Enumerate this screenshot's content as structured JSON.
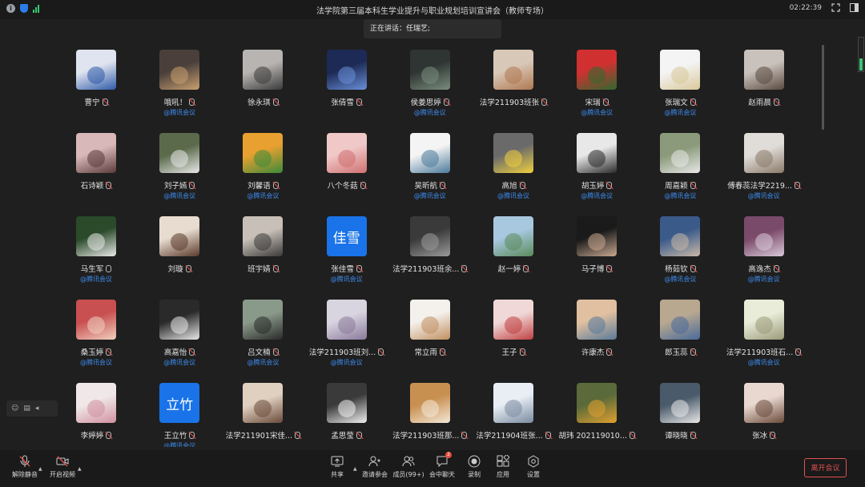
{
  "window": {
    "title": "法学院第三届本科生学业提升与职业规划培训宣讲会（教师专场）",
    "clock": "02:22:39"
  },
  "speaking": {
    "text": "正在讲话：任瑞艺;"
  },
  "platform_label": "@腾讯会议",
  "participants": [
    {
      "name": "曹宁",
      "muted": true,
      "show_platform": false,
      "avatar": {
        "type": "photo",
        "bg": "#dfe4f0",
        "fg": "#2f5aa8",
        "text": ""
      }
    },
    {
      "name": "哦吼！",
      "muted": true,
      "show_platform": true,
      "avatar": {
        "type": "photo",
        "bg": "#4a3f3a",
        "fg": "#c8a070",
        "text": ""
      }
    },
    {
      "name": "徐永琪",
      "muted": true,
      "show_platform": false,
      "avatar": {
        "type": "photo",
        "bg": "#b8b4b2",
        "fg": "#3a3a3a",
        "text": ""
      }
    },
    {
      "name": "张倩雪",
      "muted": false,
      "show_platform": false,
      "avatar": {
        "type": "photo",
        "bg": "#1c2a55",
        "fg": "#6a8fd8",
        "text": ""
      }
    },
    {
      "name": "侯姜思婷",
      "muted": true,
      "show_platform": true,
      "avatar": {
        "type": "photo",
        "bg": "#2f3533",
        "fg": "#7a8d7e",
        "text": ""
      }
    },
    {
      "name": "法学211903班张",
      "muted": true,
      "show_platform": false,
      "avatar": {
        "type": "photo",
        "bg": "#d8c8b8",
        "fg": "#b07850",
        "text": ""
      }
    },
    {
      "name": "宋瑞",
      "muted": true,
      "show_platform": true,
      "avatar": {
        "type": "photo",
        "bg": "#d03030",
        "fg": "#2f6a2f",
        "text": ""
      }
    },
    {
      "name": "张瑞文",
      "muted": true,
      "show_platform": true,
      "avatar": {
        "type": "photo",
        "bg": "#f4f4f4",
        "fg": "#d9c89a",
        "text": ""
      }
    },
    {
      "name": "赵雨晨",
      "muted": true,
      "show_platform": false,
      "avatar": {
        "type": "photo",
        "bg": "#c9c2bc",
        "fg": "#5a4a40",
        "text": ""
      }
    },
    {
      "name": "石诗颖",
      "muted": true,
      "show_platform": false,
      "avatar": {
        "type": "photo",
        "bg": "#d8b8b8",
        "fg": "#5a3a3a",
        "text": ""
      }
    },
    {
      "name": "刘子嫣",
      "muted": true,
      "show_platform": true,
      "avatar": {
        "type": "photo",
        "bg": "#5a6a4a",
        "fg": "#e8e8e8",
        "text": ""
      }
    },
    {
      "name": "刘馨语",
      "muted": true,
      "show_platform": true,
      "avatar": {
        "type": "photo",
        "bg": "#e8a030",
        "fg": "#3a8a3a",
        "text": ""
      }
    },
    {
      "name": "八个冬菇",
      "muted": true,
      "show_platform": false,
      "avatar": {
        "type": "photo",
        "bg": "#f0c8c8",
        "fg": "#d07070",
        "text": ""
      }
    },
    {
      "name": "吴昕航",
      "muted": true,
      "show_platform": true,
      "avatar": {
        "type": "photo",
        "bg": "#f4f4f4",
        "fg": "#4a7a9a",
        "text": ""
      }
    },
    {
      "name": "高旭",
      "muted": true,
      "show_platform": true,
      "avatar": {
        "type": "photo",
        "bg": "#6a6a6a",
        "fg": "#f0d040",
        "text": ""
      }
    },
    {
      "name": "胡玉婷",
      "muted": true,
      "show_platform": true,
      "avatar": {
        "type": "photo",
        "bg": "#e8e8e8",
        "fg": "#2a2a2a",
        "text": ""
      }
    },
    {
      "name": "周嘉颖",
      "muted": false,
      "show_platform": true,
      "avatar": {
        "type": "photo",
        "bg": "#8a9a7a",
        "fg": "#e8e8e8",
        "text": ""
      }
    },
    {
      "name": "傅春蕊法学2219...",
      "muted": true,
      "show_platform": true,
      "avatar": {
        "type": "photo",
        "bg": "#e0dcd8",
        "fg": "#8a7a6a",
        "text": ""
      }
    },
    {
      "name": "马生军",
      "muted": false,
      "show_platform": true,
      "mic_on": true,
      "avatar": {
        "type": "photo",
        "bg": "#2a4a2a",
        "fg": "#e8e8e8",
        "text": ""
      }
    },
    {
      "name": "刘璇",
      "muted": true,
      "show_platform": false,
      "avatar": {
        "type": "photo",
        "bg": "#e8dcd0",
        "fg": "#5a3a2a",
        "text": ""
      }
    },
    {
      "name": "班宇婧",
      "muted": true,
      "show_platform": false,
      "avatar": {
        "type": "photo",
        "bg": "#c8c0b8",
        "fg": "#3a3a3a",
        "text": ""
      }
    },
    {
      "name": "张佳雪",
      "muted": true,
      "show_platform": true,
      "avatar": {
        "type": "text",
        "bg": "#1a73e8",
        "fg": "#ffffff",
        "text": "佳雪"
      }
    },
    {
      "name": "法学211903班余...",
      "muted": true,
      "show_platform": false,
      "avatar": {
        "type": "photo",
        "bg": "#3a3a3a",
        "fg": "#9a9a9a",
        "text": ""
      }
    },
    {
      "name": "赵一婷",
      "muted": true,
      "show_platform": false,
      "avatar": {
        "type": "photo",
        "bg": "#a8c8e0",
        "fg": "#5a8a5a",
        "text": ""
      }
    },
    {
      "name": "马子博",
      "muted": true,
      "show_platform": false,
      "avatar": {
        "type": "photo",
        "bg": "#1a1a1a",
        "fg": "#c8a890",
        "text": ""
      }
    },
    {
      "name": "杨茹钦",
      "muted": true,
      "show_platform": true,
      "avatar": {
        "type": "photo",
        "bg": "#3a5a8a",
        "fg": "#c8b8a8",
        "text": ""
      }
    },
    {
      "name": "高逸杰",
      "muted": true,
      "show_platform": true,
      "avatar": {
        "type": "photo",
        "bg": "#7a4a6a",
        "fg": "#d8c8d8",
        "text": ""
      }
    },
    {
      "name": "桑玉婷",
      "muted": true,
      "show_platform": true,
      "avatar": {
        "type": "photo",
        "bg": "#c85050",
        "fg": "#f0d0c0",
        "text": ""
      }
    },
    {
      "name": "高嘉怡",
      "muted": true,
      "show_platform": true,
      "avatar": {
        "type": "photo",
        "bg": "#2a2a2a",
        "fg": "#e8e8e8",
        "text": ""
      }
    },
    {
      "name": "吕文楠",
      "muted": true,
      "show_platform": true,
      "avatar": {
        "type": "photo",
        "bg": "#8a9a8a",
        "fg": "#2a2a2a",
        "text": ""
      }
    },
    {
      "name": "法学211903班刘...",
      "muted": true,
      "show_platform": true,
      "avatar": {
        "type": "photo",
        "bg": "#d8d4e0",
        "fg": "#8a7a9a",
        "text": ""
      }
    },
    {
      "name": "常立雨",
      "muted": true,
      "show_platform": false,
      "avatar": {
        "type": "photo",
        "bg": "#f4f0ec",
        "fg": "#c09060",
        "text": ""
      }
    },
    {
      "name": "王子",
      "muted": true,
      "show_platform": false,
      "avatar": {
        "type": "photo",
        "bg": "#f0d8d8",
        "fg": "#c04040",
        "text": ""
      }
    },
    {
      "name": "许康杰",
      "muted": true,
      "show_platform": false,
      "avatar": {
        "type": "photo",
        "bg": "#e0c0a0",
        "fg": "#5a7a9a",
        "text": ""
      }
    },
    {
      "name": "郎玉蕊",
      "muted": false,
      "show_platform": false,
      "avatar": {
        "type": "photo",
        "bg": "#b8a890",
        "fg": "#4a6a9a",
        "text": ""
      }
    },
    {
      "name": "法学211903班石...",
      "muted": true,
      "show_platform": true,
      "avatar": {
        "type": "photo",
        "bg": "#e8ecd8",
        "fg": "#9a9a7a",
        "text": ""
      }
    },
    {
      "name": "李婷婷",
      "muted": true,
      "show_platform": false,
      "avatar": {
        "type": "photo",
        "bg": "#f0e8e8",
        "fg": "#d090a0",
        "text": ""
      }
    },
    {
      "name": "王立竹",
      "muted": true,
      "show_platform": true,
      "avatar": {
        "type": "text",
        "bg": "#1a73e8",
        "fg": "#ffffff",
        "text": "立竹"
      }
    },
    {
      "name": "法学211901宋佳...",
      "muted": true,
      "show_platform": false,
      "avatar": {
        "type": "photo",
        "bg": "#e0d0c0",
        "fg": "#6a4a3a",
        "text": ""
      }
    },
    {
      "name": "孟思莹",
      "muted": true,
      "show_platform": false,
      "avatar": {
        "type": "photo",
        "bg": "#3a3a3a",
        "fg": "#f0f0f0",
        "text": ""
      }
    },
    {
      "name": "法学211903班那...",
      "muted": true,
      "show_platform": false,
      "avatar": {
        "type": "photo",
        "bg": "#c89050",
        "fg": "#f4e8d8",
        "text": ""
      }
    },
    {
      "name": "法学211904班张...",
      "muted": true,
      "show_platform": false,
      "avatar": {
        "type": "photo",
        "bg": "#e8eef4",
        "fg": "#7a8aa0",
        "text": ""
      }
    },
    {
      "name": "胡玮 202119010...",
      "muted": true,
      "show_platform": false,
      "avatar": {
        "type": "photo",
        "bg": "#5a6a3a",
        "fg": "#e0a030",
        "text": ""
      }
    },
    {
      "name": "谭晓晓",
      "muted": true,
      "show_platform": false,
      "avatar": {
        "type": "photo",
        "bg": "#4a5a6a",
        "fg": "#e8e8e8",
        "text": ""
      }
    },
    {
      "name": "张冰",
      "muted": true,
      "show_platform": false,
      "avatar": {
        "type": "photo",
        "bg": "#e8d8d0",
        "fg": "#6a4a3a",
        "text": ""
      }
    }
  ],
  "volume_level": 0.35,
  "toolbar": {
    "unmute": "解除静音",
    "video": "开启视频",
    "share": "共享",
    "invite": "邀请参会",
    "members": "成员(99+)",
    "chat": "会中聊天",
    "chat_badge": "2",
    "record": "录制",
    "apps": "应用",
    "settings": "设置",
    "leave": "离开会议"
  },
  "colors": {
    "accent": "#1a73e8",
    "danger": "#e05050",
    "platform": "#3c8cf0",
    "signal": "#37c871"
  }
}
